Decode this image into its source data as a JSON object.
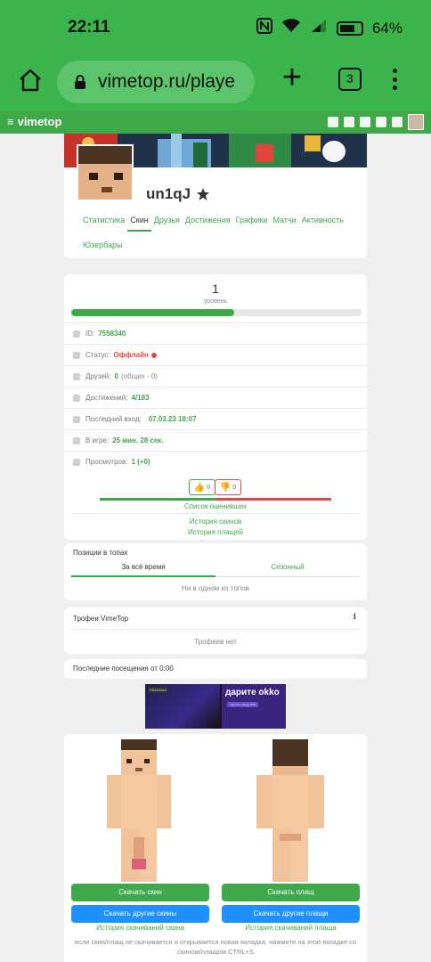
{
  "status_bar": {
    "time": "22:11",
    "battery": "64%"
  },
  "browser": {
    "url": "vimetop.ru/playe",
    "tabs_count": "3"
  },
  "site": {
    "brand": "vimetop"
  },
  "profile": {
    "username": "un1qJ",
    "tabs": [
      "Статистика",
      "Скин",
      "Друзья",
      "Достижения",
      "Графики",
      "Матчи",
      "Активность",
      "Юзербары"
    ],
    "active_tab": "Скин"
  },
  "stats": {
    "level": "1",
    "level_caption": "уровень",
    "level_progress": 0.56,
    "id_label": "ID:",
    "id_value": "7558340",
    "status_label": "Статус:",
    "status_value": "Оффлайн",
    "friends_label": "Друзей:",
    "friends_value": "0",
    "friends_common": "(общих - 0)",
    "achievements_label": "Достижений:",
    "achievements_value": "4/183",
    "last_login_label": "Последний вход:",
    "last_login_value": "07.03.23 18:07",
    "ingame_label": "В игре:",
    "ingame_value": "25 мин. 28 сек.",
    "views_label": "Просмотров:",
    "views_value": "1 (+0)",
    "likes": "0",
    "dislikes": "0",
    "raters_link": "Список оценивших",
    "skin_history_link": "История скинов",
    "cape_history_link": "История плащей"
  },
  "tops": {
    "title": "Позиции в топах",
    "tab_all": "За всё время",
    "tab_season": "Сезонный",
    "empty": "Ни в одном из топов"
  },
  "trophies": {
    "title": "Трофеи VimeTop",
    "info": "i",
    "empty": "Трофеев нет"
  },
  "visits": {
    "text": "Последние посещения от 0:00"
  },
  "ad": {
    "badge": "РЕКЛАМА",
    "title": "дарите okko",
    "cta": "получить скидку 50%"
  },
  "skins": {
    "download_skin": "Скачать скин",
    "download_other_skins": "Скачать другие скины",
    "skin_history": "История скачиваний скина",
    "download_cape": "Скачать плащ",
    "download_other_capes": "Скачать другие плащи",
    "cape_history": "История скачиваний плаща",
    "note": "если скин/плащ не скачивается и открывается новая вкладка, нажмите на этой вкладке со скином/плащом CTRL+S"
  },
  "colors": {
    "brand_green": "#3ea84a",
    "chrome_green": "#3bb44b",
    "offline_red": "#e04848",
    "button_blue": "#1e90ff"
  }
}
